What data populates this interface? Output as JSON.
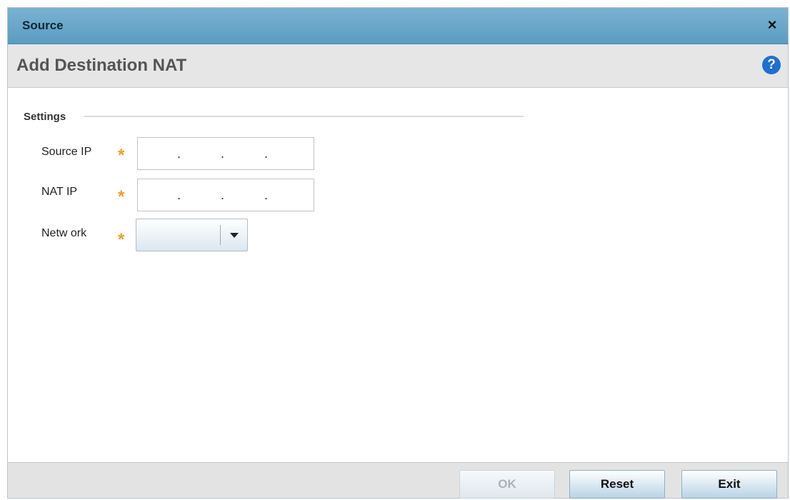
{
  "dialog": {
    "title": "Source",
    "close_icon": "×",
    "page_title": "Add Destination NAT",
    "help_icon": "?"
  },
  "settings": {
    "legend": "Settings",
    "required_marker": "*",
    "source_ip": {
      "label": "Source IP",
      "value": "",
      "separator": "."
    },
    "nat_ip": {
      "label": "NAT IP",
      "value": "",
      "separator": "."
    },
    "network": {
      "label": "Netw ork",
      "selected": ""
    }
  },
  "footer": {
    "ok_label": "OK",
    "reset_label": "Reset",
    "exit_label": "Exit"
  },
  "colors": {
    "titlebar": "#6aa8cc",
    "required_star": "#f59a23",
    "help": "#1f6fd1"
  }
}
